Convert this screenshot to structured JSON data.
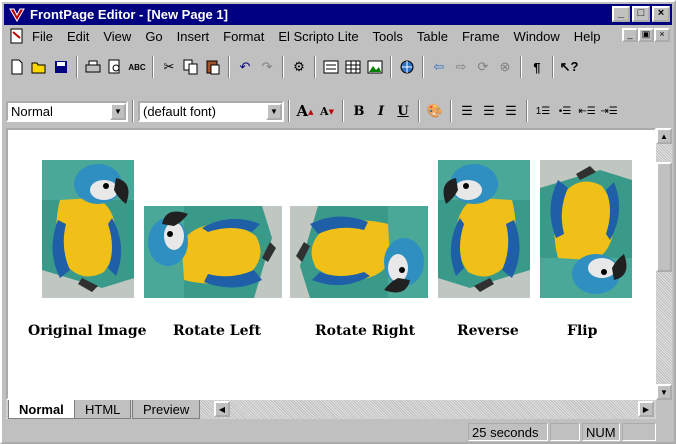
{
  "window": {
    "title": "FrontPage Editor - [New Page 1]",
    "controls": [
      "_",
      "□",
      "×"
    ]
  },
  "menu": {
    "items": [
      "File",
      "Edit",
      "View",
      "Go",
      "Insert",
      "Format",
      "El Scripto Lite",
      "Tools",
      "Table",
      "Frame",
      "Window",
      "Help"
    ]
  },
  "toolbar": {
    "style_value": "Normal",
    "font_value": "(default font)"
  },
  "images": {
    "captions": [
      "Original Image",
      "Rotate Left",
      "Rotate Right",
      "Reverse",
      "Flip"
    ]
  },
  "tabs": [
    "Normal",
    "HTML",
    "Preview"
  ],
  "status": {
    "time": "25 seconds",
    "num": "NUM"
  },
  "colors": {
    "titlebar": "#000080",
    "face": "#c0c0c0",
    "bird_yellow": "#f0c018",
    "bird_teal": "#3a9a8a"
  }
}
